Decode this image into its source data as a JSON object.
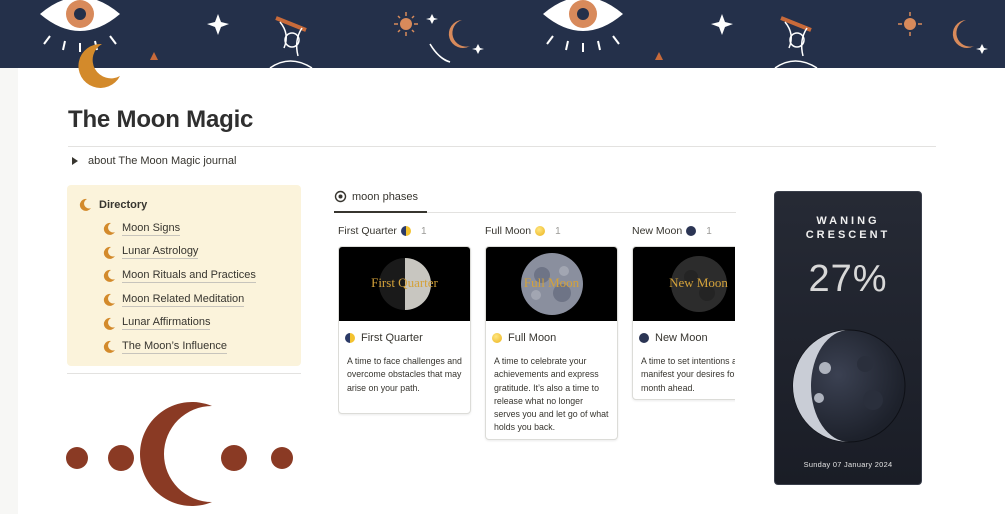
{
  "page": {
    "title": "The Moon Magic",
    "toggle_label": "about The Moon Magic journal"
  },
  "directory": {
    "heading": "Directory",
    "items": [
      {
        "label": "Moon Signs"
      },
      {
        "label": "Lunar Astrology"
      },
      {
        "label": "Moon Rituals and Practices"
      },
      {
        "label": "Moon Related Meditation"
      },
      {
        "label": "Lunar Affirmations"
      },
      {
        "label": "The Moon’s Influence"
      }
    ]
  },
  "board": {
    "tab_label": "moon phases",
    "columns": [
      {
        "name": "First Quarter",
        "count": "1",
        "card": {
          "cover_text": "First Quarter",
          "title": "First Quarter",
          "description": "A time to face challenges and overcome obstacles that may arise on your path."
        }
      },
      {
        "name": "Full Moon",
        "count": "1",
        "card": {
          "cover_text": "Full Moon",
          "title": "Full Moon",
          "description": "A time to celebrate your achievements and express gratitude. It’s also a time to release what no longer serves you and let go of what holds you back."
        }
      },
      {
        "name": "New Moon",
        "count": "1",
        "card": {
          "cover_text": "New Moon",
          "title": "New Moon",
          "description": "A time to set intentions and manifest your desires for the month ahead."
        }
      }
    ]
  },
  "widget": {
    "phase_line1": "WANING",
    "phase_line2": "CRESCENT",
    "illumination": "27%",
    "date": "Sunday 07 January 2024"
  },
  "colors": {
    "banner": "#24304a",
    "directory_bg": "#fbf3db",
    "moon_icon": "#d38a2b",
    "decoration": "#8a3a24"
  }
}
